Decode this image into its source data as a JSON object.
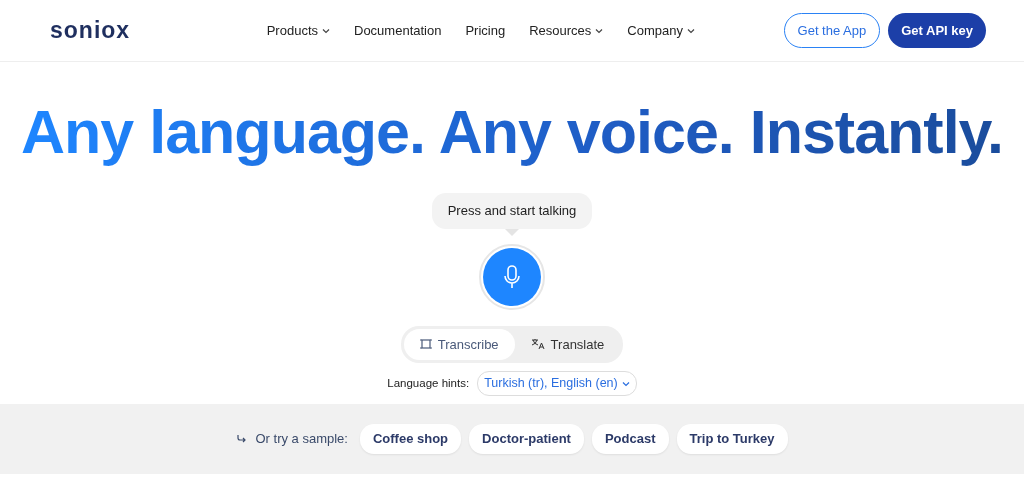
{
  "header": {
    "logo": "soniox",
    "nav": [
      {
        "label": "Products",
        "dropdown": true
      },
      {
        "label": "Documentation",
        "dropdown": false
      },
      {
        "label": "Pricing",
        "dropdown": false
      },
      {
        "label": "Resources",
        "dropdown": true
      },
      {
        "label": "Company",
        "dropdown": true
      }
    ],
    "buttons": [
      {
        "label": "Get the App",
        "kind": "outline"
      },
      {
        "label": "Get API key",
        "kind": "solid"
      }
    ]
  },
  "hero": {
    "headline": "Any language. Any voice. Instantly.",
    "tooltip": "Press and start talking",
    "modes": [
      {
        "label": "Transcribe",
        "kind": "transcribe",
        "selected": true
      },
      {
        "label": "Translate",
        "kind": "translate",
        "selected": false
      }
    ],
    "language_hints": {
      "label": "Language hints:",
      "value": "Turkish (tr), English (en)"
    }
  },
  "samples": {
    "label": "Or try a sample:",
    "items": [
      "Coffee shop",
      "Doctor-patient",
      "Podcast",
      "Trip to Turkey"
    ]
  }
}
